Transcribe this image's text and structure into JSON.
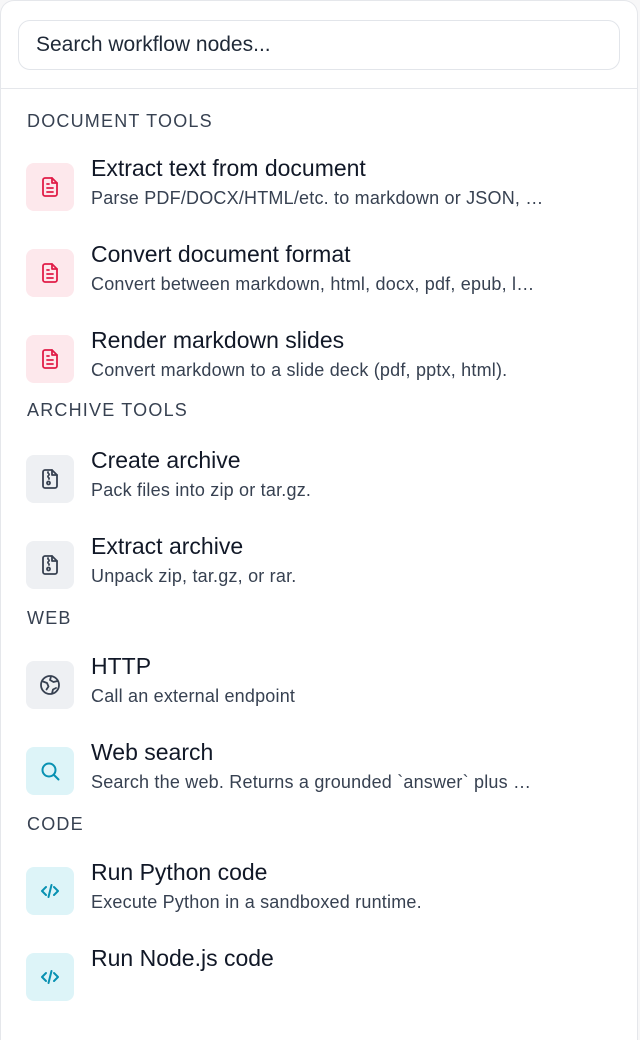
{
  "search": {
    "placeholder": "Search workflow nodes..."
  },
  "sections": [
    {
      "title": "DOCUMENT TOOLS",
      "items": [
        {
          "title": "Extract text from document",
          "desc": "Parse PDF/DOCX/HTML/etc. to markdown or JSON, …",
          "icon": "document-icon",
          "color": "#e11d48"
        },
        {
          "title": "Convert document format",
          "desc": "Convert between markdown, html, docx, pdf, epub, l…",
          "icon": "document-icon",
          "color": "#e11d48"
        },
        {
          "title": "Render markdown slides",
          "desc": "Convert markdown to a slide deck (pdf, pptx, html).",
          "icon": "document-icon",
          "color": "#e11d48"
        }
      ]
    },
    {
      "title": "ARCHIVE TOOLS",
      "items": [
        {
          "title": "Create archive",
          "desc": "Pack files into zip or tar.gz.",
          "icon": "archive-icon",
          "color": "#374151"
        },
        {
          "title": "Extract archive",
          "desc": "Unpack zip, tar.gz, or rar.",
          "icon": "archive-icon",
          "color": "#374151"
        }
      ]
    },
    {
      "title": "WEB",
      "items": [
        {
          "title": "HTTP",
          "desc": "Call an external endpoint",
          "icon": "globe-icon",
          "color": "#374151"
        },
        {
          "title": "Web search",
          "desc": "Search the web. Returns a grounded `answer` plus …",
          "icon": "search-icon",
          "color": "#0891b2"
        }
      ]
    },
    {
      "title": "CODE",
      "items": [
        {
          "title": "Run Python code",
          "desc": "Execute Python in a sandboxed runtime.",
          "icon": "code-icon",
          "color": "#0891b2"
        },
        {
          "title": "Run Node.js code",
          "desc": "",
          "icon": "code-icon",
          "color": "#0891b2"
        }
      ]
    }
  ]
}
